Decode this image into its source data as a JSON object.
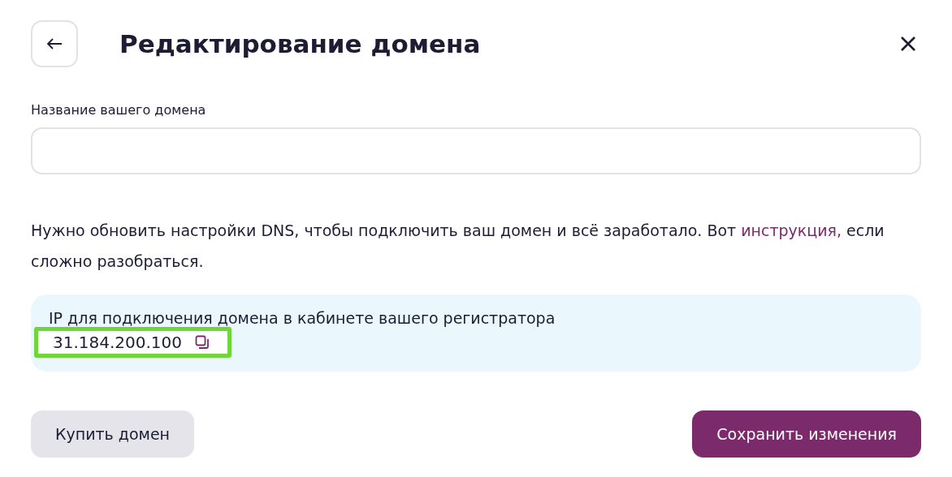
{
  "header": {
    "title": "Редактирование домена"
  },
  "domain_field": {
    "label": "Название вашего домена"
  },
  "notice": {
    "text": "Нужно обновить настройки DNS, чтобы подключить ваш домен и всё заработало. Вот",
    "link": "инструкция,",
    "tail": "если сложно разобраться."
  },
  "ip_box": {
    "caption": "IP для подключения домена в кабинете вашего регистратора",
    "ip": "31.184.200.100",
    "highlighted": true
  },
  "buttons": [
    {
      "label": "Купить домен",
      "kind": "secondary"
    },
    {
      "label": "Сохранить изменения",
      "kind": "primary"
    }
  ]
}
